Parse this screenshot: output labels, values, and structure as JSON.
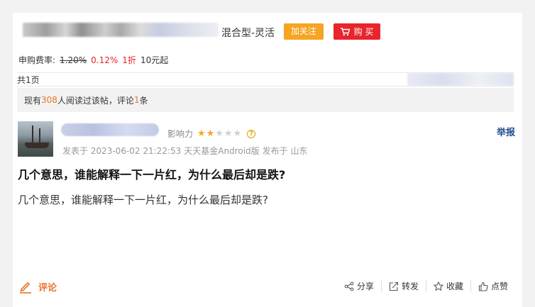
{
  "header": {
    "fund_type": "混合型-灵活",
    "follow_label": "加关注",
    "buy_label": "购 买"
  },
  "fee": {
    "label": "申购费率:",
    "old_rate": "1.20%",
    "new_rate": "0.12%",
    "discount": "1折",
    "min_amount": "10元起"
  },
  "pagination": {
    "text": "共1页"
  },
  "read_info": {
    "prefix": "现有",
    "count": "308",
    "mid": "人阅读过该帖，评论",
    "comments": "1",
    "suffix": "条"
  },
  "post": {
    "influence_label": "影响力",
    "stars_total": 5,
    "stars_filled": 2,
    "report_label": "举报",
    "meta_posted": "发表于 2023-06-02 21:22:53",
    "meta_source": "天天基金Android版",
    "meta_location": "发布于 山东",
    "title": "几个意思，谁能解释一下一片红，为什么最后却是跌?",
    "body": "几个意思，谁能解释一下一片红，为什么最后却是跌?"
  },
  "footer": {
    "comment_label": "评论",
    "share_label": "分享",
    "forward_label": "转发",
    "favorite_label": "收藏",
    "like_label": "点赞"
  },
  "colors": {
    "accent_orange": "#e8752c",
    "buy_red": "#e8242c",
    "follow_orange": "#f5a423",
    "report_blue": "#1d4b8f"
  }
}
